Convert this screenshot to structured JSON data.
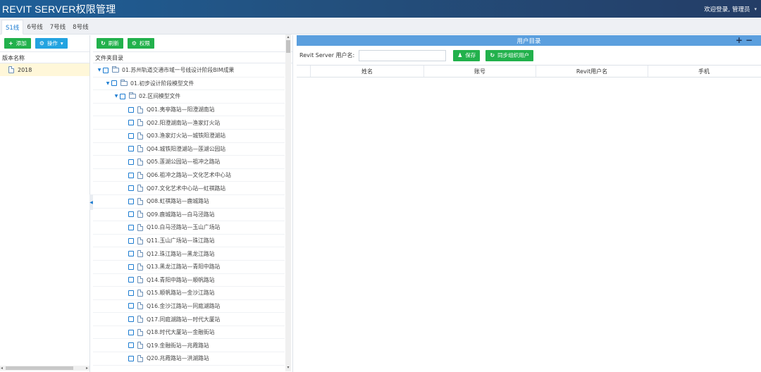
{
  "header": {
    "title": "REVIT SERVER权限管理",
    "welcome": "欢迎登录,",
    "user": "管理员"
  },
  "tabs": [
    {
      "label": "S1线",
      "active": true
    },
    {
      "label": "6号线",
      "active": false
    },
    {
      "label": "7号线",
      "active": false
    },
    {
      "label": "8号线",
      "active": false
    }
  ],
  "left_panel": {
    "add_label": "添加",
    "operate_label": "操作",
    "column_header": "版本名称",
    "items": [
      "2018"
    ]
  },
  "mid_panel": {
    "refresh_label": "刷新",
    "permission_label": "权限",
    "column_header": "文件夹目录",
    "tree": [
      {
        "level": 0,
        "type": "folder",
        "expanded": true,
        "label": "01.苏州轨道交通市域一号线设计阶段BIM成果"
      },
      {
        "level": 1,
        "type": "folder",
        "expanded": true,
        "label": "01.初步设计阶段模型文件"
      },
      {
        "level": 2,
        "type": "folder",
        "expanded": true,
        "label": "02.区间模型文件"
      },
      {
        "level": 3,
        "type": "file",
        "label": "Q01.夷亭路站—阳澄湖南站"
      },
      {
        "level": 3,
        "type": "file",
        "label": "Q02.阳澄湖南站—渔家灯火站"
      },
      {
        "level": 3,
        "type": "file",
        "label": "Q03.渔家灯火站—城铁阳澄湖站"
      },
      {
        "level": 3,
        "type": "file",
        "label": "Q04.城铁阳澄湖站—莲湖公园站"
      },
      {
        "level": 3,
        "type": "file",
        "label": "Q05.莲湖公园站—祖冲之路站"
      },
      {
        "level": 3,
        "type": "file",
        "label": "Q06.祖冲之路站—文化艺术中心站"
      },
      {
        "level": 3,
        "type": "file",
        "label": "Q07.文化艺术中心站—虹祺路站"
      },
      {
        "level": 3,
        "type": "file",
        "label": "Q08.虹祺路站—鹿城路站"
      },
      {
        "level": 3,
        "type": "file",
        "label": "Q09.鹿城路站—白马泾路站"
      },
      {
        "level": 3,
        "type": "file",
        "label": "Q10.白马泾路站—玉山广场站"
      },
      {
        "level": 3,
        "type": "file",
        "label": "Q11.玉山广场站—珠江路站"
      },
      {
        "level": 3,
        "type": "file",
        "label": "Q12.珠江路站—黑龙江路站"
      },
      {
        "level": 3,
        "type": "file",
        "label": "Q13.黑龙江路站—青阳中路站"
      },
      {
        "level": 3,
        "type": "file",
        "label": "Q14.青阳中路站—顺帆路站"
      },
      {
        "level": 3,
        "type": "file",
        "label": "Q15.顺帆路站—金沙江路站"
      },
      {
        "level": 3,
        "type": "file",
        "label": "Q16.金沙江路站—同庭湖路站"
      },
      {
        "level": 3,
        "type": "file",
        "label": "Q17.同庭湖路站—时代大厦站"
      },
      {
        "level": 3,
        "type": "file",
        "label": "Q18.时代大厦站—金融街站"
      },
      {
        "level": 3,
        "type": "file",
        "label": "Q19.金融街站—兆霞路站"
      },
      {
        "level": 3,
        "type": "file",
        "label": "Q20.兆霞路站—洪湖路站"
      }
    ]
  },
  "right_panel": {
    "title": "用户目录",
    "expand_symbol": "+",
    "collapse_symbol": "−",
    "username_label": "Revit Server 用户名:",
    "username_value": "",
    "save_label": "保存",
    "sync_label": "同步组织用户",
    "columns": [
      "姓名",
      "账号",
      "Revit用户名",
      "手机"
    ]
  },
  "colors": {
    "header_bg": "#23517f",
    "button_green": "#22b14c",
    "button_blue": "#23a3e0",
    "panel_head": "#5b9fde",
    "selected_row": "#fff7d9"
  }
}
